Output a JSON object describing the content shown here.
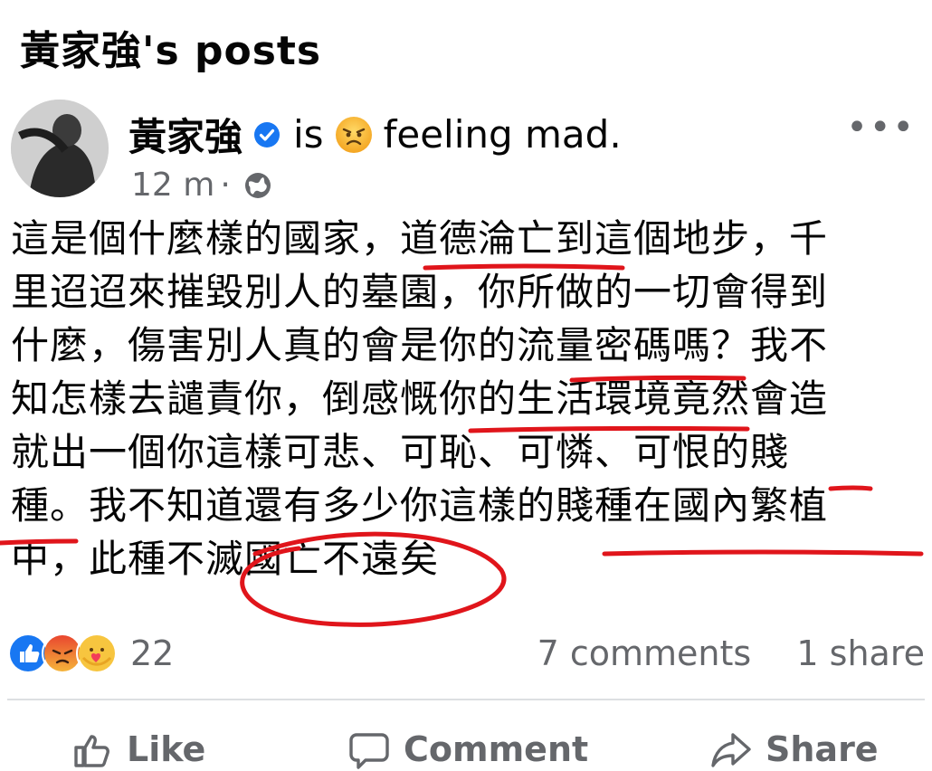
{
  "page": {
    "title": "黃家強's posts"
  },
  "post": {
    "author": "黃家強",
    "feeling_prefix": "is",
    "feeling_text": "feeling mad.",
    "feeling_emoji": "angry-face",
    "time": "12 m",
    "separator": "·",
    "audience_icon": "globe-icon",
    "more_label": "•••",
    "lines": [
      "這是個什麼樣的國家，道德淪亡到這個地步，千",
      "里迢迢來摧毀別人的墓園，你所做的一切會得到",
      "什麼，傷害別人真的會是你的流量密碼嗎？我不",
      "知怎樣去譴責你，倒感慨你的生活環境竟然會造",
      "就出一個你這樣可悲、可恥、可憐、可恨的賤",
      "種。我不知道還有多少你這樣的賤種在國內繁植",
      "中，此種不滅國亡不遠矣"
    ]
  },
  "stats": {
    "reactions": [
      "like",
      "angry",
      "care"
    ],
    "reaction_count": "22",
    "comments": "7 comments",
    "shares": "1 share"
  },
  "actions": {
    "like": "Like",
    "comment": "Comment",
    "share": "Share"
  },
  "colors": {
    "annotation_red": "#e0151b",
    "verified_blue": "#1877f2",
    "secondary_text": "#65676b"
  }
}
